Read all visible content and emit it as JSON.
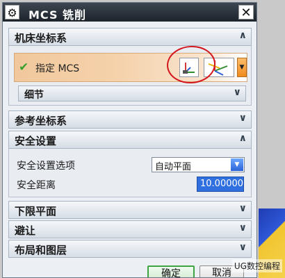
{
  "titlebar": {
    "title": "MCS 铣削",
    "gear_icon": "gear-icon",
    "close_label": "✕"
  },
  "sections": {
    "machine_csys": "机床坐标系",
    "reference_csys": "参考坐标系",
    "clearance": "安全设置",
    "lower_limit": "下限平面",
    "avoidance": "避让",
    "layout_layers": "布局和图层"
  },
  "mcs": {
    "label": "指定 MCS",
    "details": "细节"
  },
  "clearance": {
    "option_label": "安全设置选项",
    "option_value": "自动平面",
    "distance_label": "安全距离",
    "distance_value": "10.00000"
  },
  "buttons": {
    "ok": "确定",
    "cancel": "取消"
  },
  "watermark": "UG数控编程",
  "colors": {
    "accent_orange": "#f5d2ab",
    "ok_border": "#3ea442",
    "field_blue": "#2f6fe0"
  }
}
